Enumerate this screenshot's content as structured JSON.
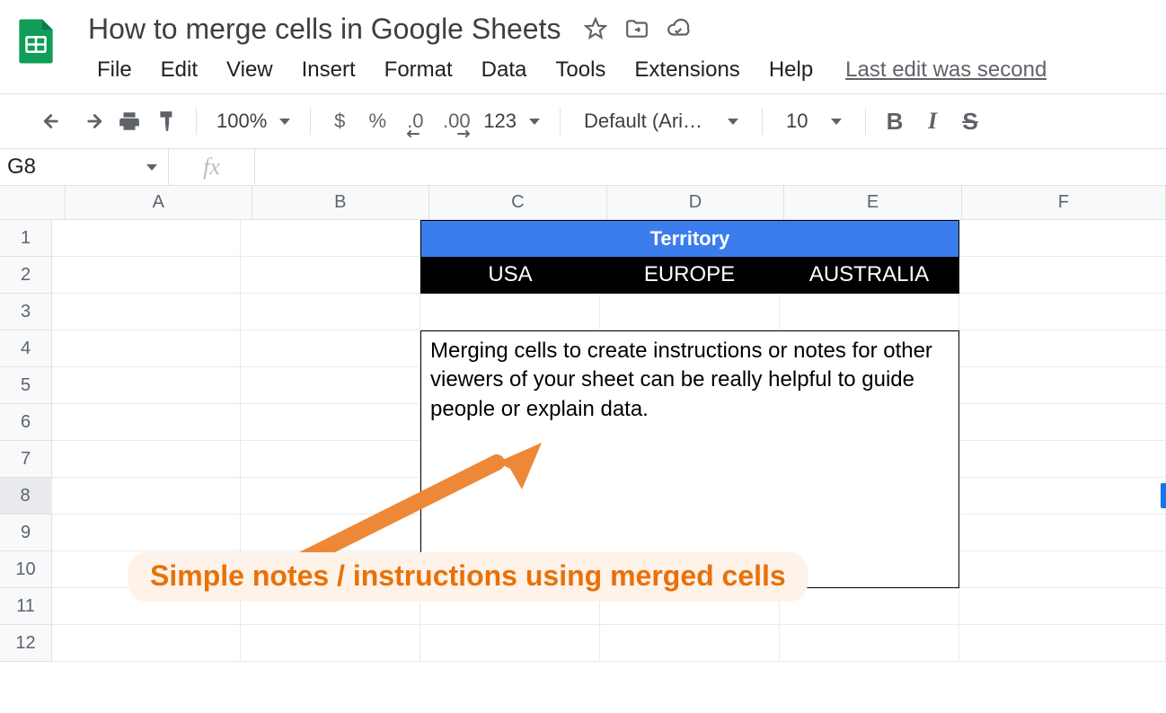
{
  "doc": {
    "title": "How to merge cells in Google Sheets",
    "last_edit": "Last edit was second"
  },
  "menus": {
    "file": "File",
    "edit": "Edit",
    "view": "View",
    "insert": "Insert",
    "format": "Format",
    "data": "Data",
    "tools": "Tools",
    "extensions": "Extensions",
    "help": "Help"
  },
  "toolbar": {
    "zoom": "100%",
    "currency": "$",
    "percent": "%",
    "dec_dec": ".0",
    "inc_dec": ".00",
    "more_fmt": "123",
    "font": "Default (Ari…",
    "font_size": "10",
    "bold": "B",
    "italic": "I",
    "strike": "S"
  },
  "namebox": {
    "ref": "G8"
  },
  "fx": {
    "label": "fx",
    "value": ""
  },
  "columns": [
    "A",
    "B",
    "C",
    "D",
    "E",
    "F"
  ],
  "rows": [
    "1",
    "2",
    "3",
    "4",
    "5",
    "6",
    "7",
    "8",
    "9",
    "10",
    "11",
    "12"
  ],
  "sheet": {
    "territory_header": "Territory",
    "sub": {
      "c": "USA",
      "d": "EUROPE",
      "e": "AUSTRALIA"
    },
    "note": "Merging cells to create instructions or notes for other viewers of your sheet can be really helpful to guide people or explain data."
  },
  "annotation": {
    "text": "Simple notes / instructions using merged cells"
  }
}
